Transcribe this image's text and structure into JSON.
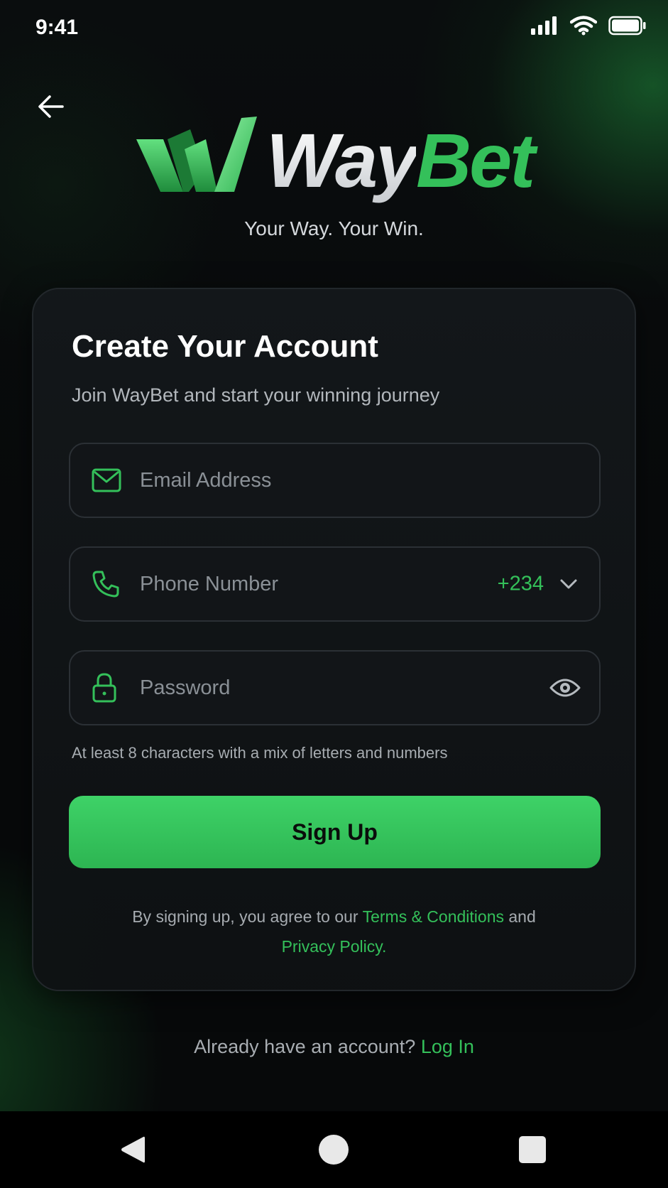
{
  "status_bar": {
    "time": "9:41",
    "icons": [
      "signal-icon",
      "wifi-icon",
      "battery-icon"
    ]
  },
  "header": {
    "back_icon": "arrow-left-icon"
  },
  "brand": {
    "name_part1": "Way",
    "name_part2": "Bet",
    "tagline": "Your Way. Your Win.",
    "accent_color": "#34c05a"
  },
  "form": {
    "title": "Create Your Account",
    "subtitle": "Join WayBet and start your winning journey",
    "email": {
      "placeholder": "Email Address",
      "value": "",
      "icon": "mail-icon"
    },
    "phone": {
      "placeholder": "Phone Number",
      "value": "",
      "icon": "phone-icon",
      "country_code": "+234"
    },
    "password": {
      "placeholder": "Password",
      "value": "",
      "icon": "lock-icon",
      "toggle_icon": "eye-icon"
    },
    "password_hint": "At least 8 characters with a mix of letters and numbers",
    "submit_label": "Sign Up",
    "terms": {
      "prefix": "By signing up, you agree to our ",
      "terms_link": "Terms & Conditions",
      "middle": " and",
      "privacy_link": "Privacy Policy."
    }
  },
  "footer": {
    "prompt": "Already have an account? ",
    "login_link": "Log In"
  },
  "nav_bar": {
    "buttons": [
      "nav-back-icon",
      "nav-home-icon",
      "nav-recent-icon"
    ]
  }
}
